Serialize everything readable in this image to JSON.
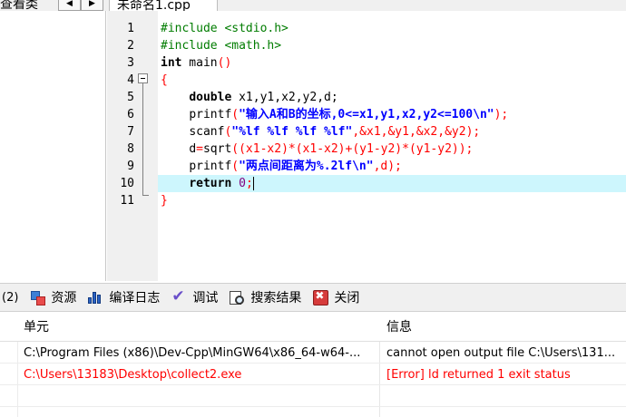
{
  "top": {
    "class_tab": "查看类",
    "nav_prev": "◀",
    "nav_next": "▶",
    "file_tab": "未命名1.cpp"
  },
  "editor": {
    "line_numbers": [
      "1",
      "2",
      "3",
      "4",
      "5",
      "6",
      "7",
      "8",
      "9",
      "10",
      "11"
    ],
    "line1": "#include <stdio.h>",
    "line2": "#include <math.h>",
    "line3_kw": "int",
    "line3_id": " main",
    "line3_sym": "()",
    "line4_sym": "{",
    "line5_kw": "double",
    "line5_vars": " x1,y1,x2,y2,d;",
    "line6_fn": "printf",
    "line6_open": "(",
    "line6_str": "\"输入A和B的坐标,0<=x1,y1,x2,y2<=100\\n\"",
    "line6_close": ");",
    "line7_fn": "scanf",
    "line7_open": "(",
    "line7_str": "\"%lf %lf %lf %lf\"",
    "line7_args": ",&x1,&y1,&x2,&y2);",
    "line8_lhs": "d",
    "line8_eq": "=",
    "line8_fn": "sqrt",
    "line8_expr": "((x1-x2)*(x1-x2)+(y1-y2)*(y1-y2));",
    "line9_fn": "printf",
    "line9_open": "(",
    "line9_str": "\"两点间距离为%.2lf\\n\"",
    "line9_args": ",d);",
    "line10_kw": "return",
    "line10_num": "0",
    "line10_semi": ";",
    "line11_sym": "}"
  },
  "tabs": {
    "first": "(2)",
    "resources": "资源",
    "compile_log": "编译日志",
    "debug": "调试",
    "search_results": "搜索结果",
    "close": "关闭"
  },
  "log": {
    "col_unit": "单元",
    "col_info": "信息",
    "rows": [
      {
        "unit": "C:\\Program Files (x86)\\Dev-Cpp\\MinGW64\\x86_64-w64-...",
        "info": "cannot open output file C:\\Users\\131..."
      },
      {
        "unit": "C:\\Users\\13183\\Desktop\\collect2.exe",
        "info": "[Error] ld returned 1 exit status"
      }
    ]
  },
  "colors": {
    "preprocessor": "#007c00",
    "symbol": "#ff0000",
    "string": "#0000ff",
    "number": "#800080",
    "current_line": "#cdf6fd",
    "error_text": "#ff0000"
  }
}
